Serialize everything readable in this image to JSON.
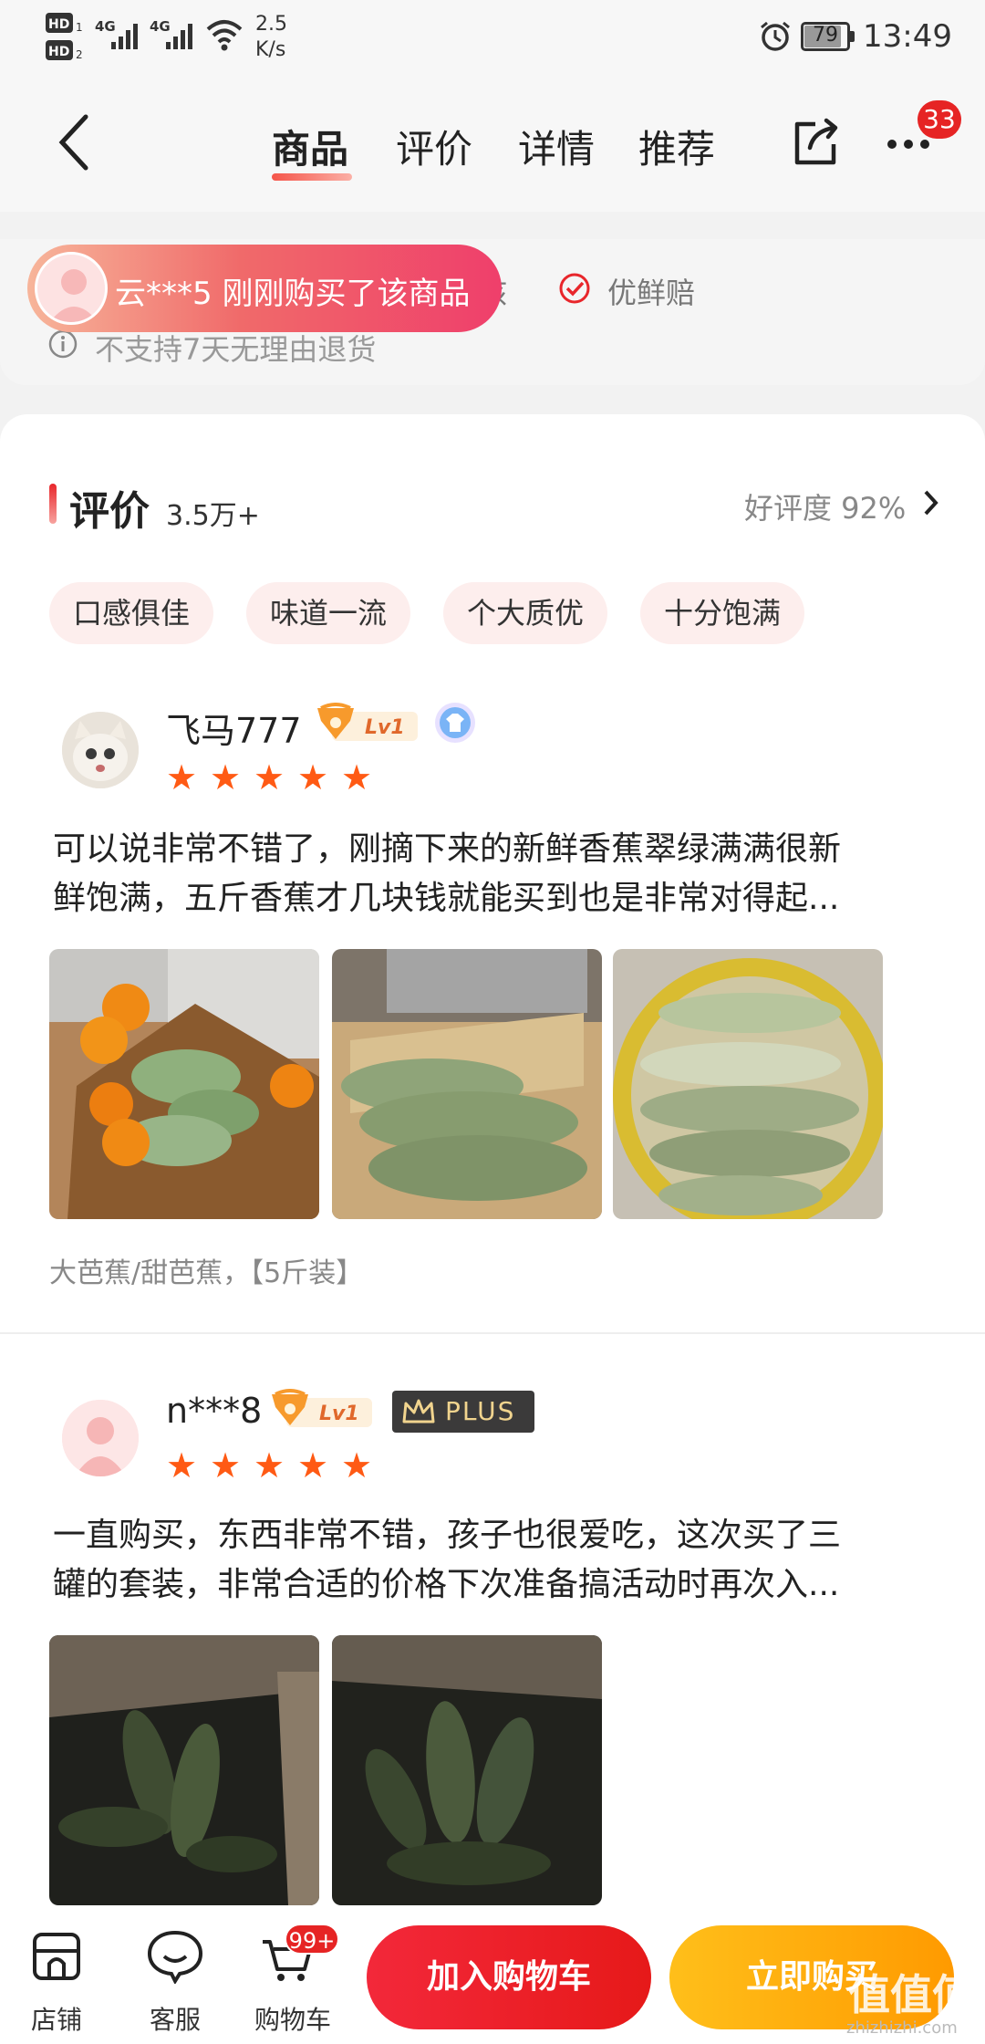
{
  "status_bar": {
    "net_speed_value": "2.5",
    "net_speed_unit": "K/s",
    "battery": "79",
    "time": "13:49",
    "signal_1": "4G",
    "signal_2": "4G"
  },
  "nav": {
    "tabs": [
      {
        "label": "商品",
        "active": true
      },
      {
        "label": "评价",
        "active": false
      },
      {
        "label": "详情",
        "active": false
      },
      {
        "label": "推荐",
        "active": false
      }
    ],
    "more_badge": "33"
  },
  "service": {
    "items": [
      "核",
      "优鲜赔"
    ],
    "notice": "不支持7天无理由退货"
  },
  "toast": {
    "text": "云***5 刚刚购买了该商品"
  },
  "reviews_section": {
    "title": "评价",
    "count": "3.5万+",
    "rating_text": "好评度 92%",
    "tags": [
      "口感俱佳",
      "味道一流",
      "个大质优",
      "十分饱满"
    ]
  },
  "reviews": [
    {
      "username": "飞马777",
      "level_badge": "Lv1",
      "stars": 5,
      "text_line1": "可以说非常不错了，刚摘下来的新鲜香蕉翠绿满满很新",
      "text_line2": "鲜饱满，五斤香蕉才几块钱就能买到也是非常对得起...",
      "spec": "大芭蕉/甜芭蕉，【5斤装】"
    },
    {
      "username": "n***8",
      "level_badge": "Lv1",
      "plus_badge": "PLUS",
      "stars": 5,
      "text_line1": "一直购买，东西非常不错，孩子也很爱吃，这次买了三",
      "text_line2": "罐的套装，非常合适的价格下次准备搞活动时再次入..."
    }
  ],
  "bottom_bar": {
    "store_label": "店铺",
    "service_label": "客服",
    "cart_label": "购物车",
    "cart_badge": "99+",
    "add_to_cart": "加入购物车",
    "buy_now": "立即购买",
    "watermark": "值值值",
    "watermark_sub": "zhizhizhi.com"
  },
  "colors": {
    "accent_red": "#e8262b",
    "accent_orange": "#ffa600",
    "star": "#ff5a14"
  }
}
